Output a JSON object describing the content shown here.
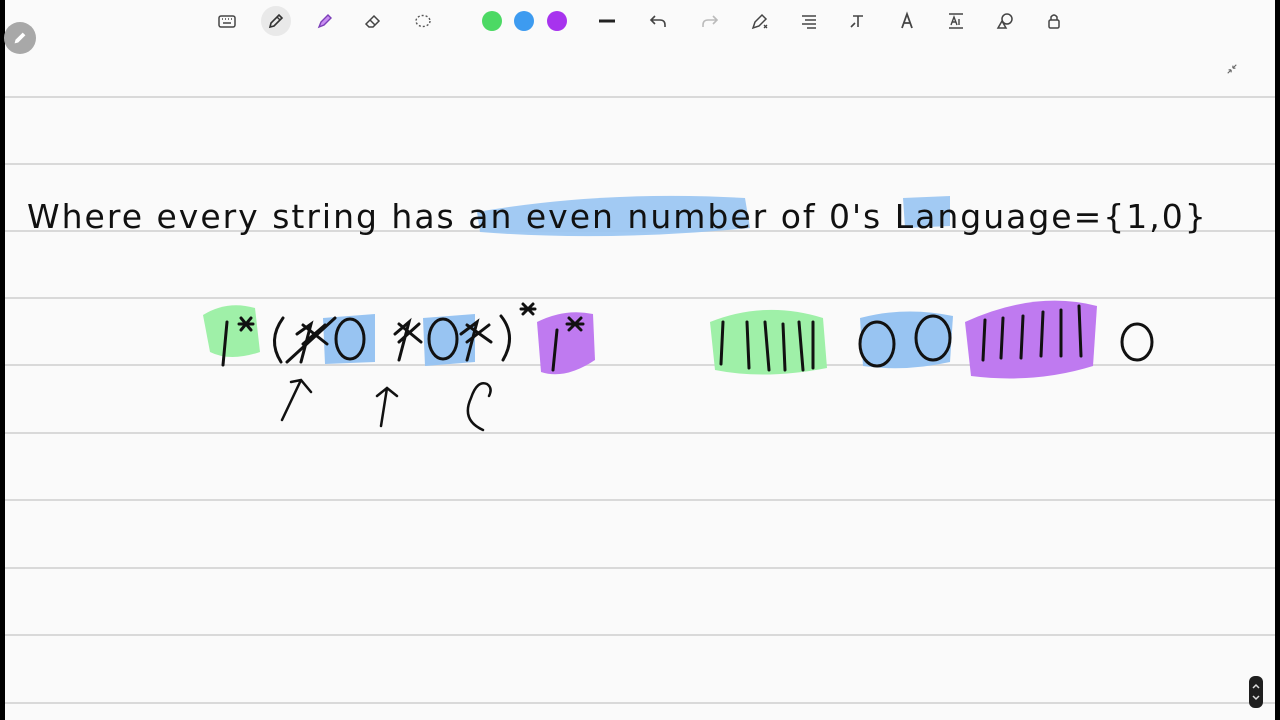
{
  "app": {
    "toolbar": {
      "tools": [
        {
          "name": "keyboard-icon",
          "label": "keyboard"
        },
        {
          "name": "pen-icon",
          "label": "pen",
          "active": true
        },
        {
          "name": "highlighter-icon",
          "label": "highlighter"
        },
        {
          "name": "eraser-icon",
          "label": "eraser"
        },
        {
          "name": "lasso-icon",
          "label": "lasso"
        }
      ],
      "colors": [
        "#4cd964",
        "#3d9bf0",
        "#a733ee"
      ],
      "stroke_color": "#222222",
      "right_tools": [
        "undo-icon",
        "redo-icon",
        "shape-pen-icon",
        "text-align-icon",
        "text-tool-icon",
        "font-icon",
        "text-convert-icon",
        "shapes-icon",
        "lock-icon"
      ]
    },
    "page": {
      "line_text": "Where every string has an even number of 0's Language={1,0}",
      "expression": "1*(1*01*01*)*1*",
      "example_string": "11111 00 11111 0"
    },
    "highlights": {
      "green": "#9ff0a8",
      "blue": "#98c4f2",
      "purple": "#bf7af0"
    }
  }
}
